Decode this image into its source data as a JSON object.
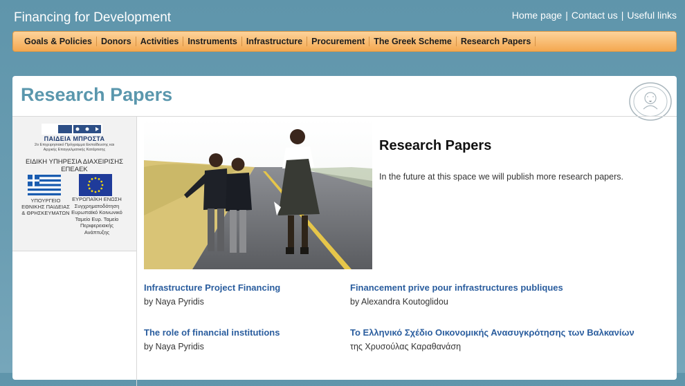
{
  "header": {
    "site_title": "Financing for Development",
    "links": [
      "Home page",
      "Contact us",
      "Useful links"
    ],
    "separator": "|"
  },
  "nav": {
    "items": [
      "Goals & Policies",
      "Donors",
      "Activities",
      "Instruments",
      "Infrastructure",
      "Procurement",
      "The Greek Scheme",
      "Research Papers"
    ]
  },
  "page": {
    "heading": "Research Papers"
  },
  "sidebar": {
    "program_name": "ΠΑΙΔΕΙΑ ΜΠΡΟΣΤΑ",
    "program_sub": "2ο Επιχειρησιακό Πρόγραμμα Εκπαίδευσης και Αρχικής Επαγγελματικής Κατάρτισης",
    "agency": "ΕΙΔΙΚΗ ΥΠΗΡΕΣΙΑ ΔΙΑΧΕΙΡΙΣΗΣ ΕΠΕΑΕΚ",
    "ministry": "ΥΠΟΥΡΓΕΙΟ ΕΘΝΙΚΗΣ ΠΑΙΔΕΙΑΣ & ΘΡΗΣΚΕΥΜΑΤΩΝ",
    "eu_text": "ΕΥΡΩΠΑΪΚΗ ΕΝΩΣΗ Συγχρηματοδότηση Ευρωπαϊκό Κοινωνικό Ταμείο Ευρ. Ταμείο Περιφερειακής Ανάπτυξης"
  },
  "content": {
    "title": "Research Papers",
    "text": "In the future at this space we will publish more research papers."
  },
  "papers": [
    {
      "title": "Infrastructure Project Financing",
      "author": "by Naya Pyridis"
    },
    {
      "title": "Financement prive pour infrastructures publiques",
      "author": "by Alexandra Koutoglidou"
    },
    {
      "title": "The role of financial institutions",
      "author": "by Naya Pyridis"
    },
    {
      "title": "Το Ελληνικό  Σχέδιο Οικονομικής Ανασυγκρότησης των Βαλκανίων",
      "author": "της Χρυσούλας Καραθανάση"
    }
  ],
  "colors": {
    "background": "#6a9db2",
    "nav": "#f4a850",
    "heading": "#5a97ad",
    "link": "#2a5d9e"
  }
}
